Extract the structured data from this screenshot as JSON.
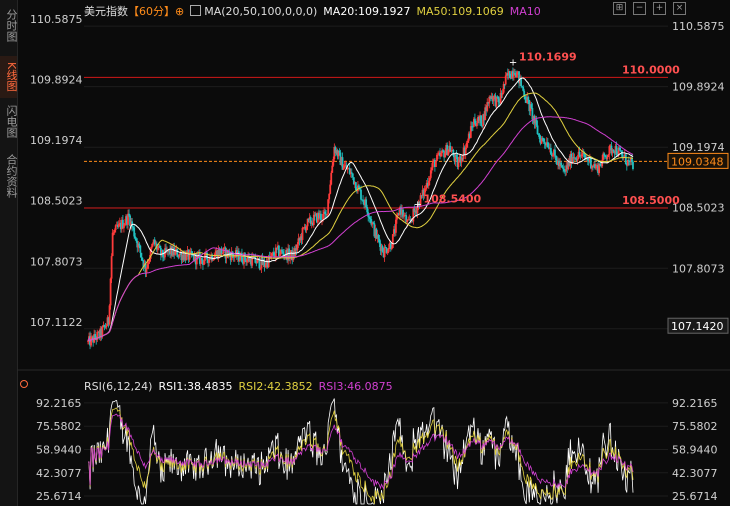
{
  "sidebar": {
    "tabs": [
      {
        "label": "分时图",
        "active": false
      },
      {
        "label": "K线图",
        "active": true
      },
      {
        "label": "闪电图",
        "active": false
      },
      {
        "label": "合约资料",
        "active": false
      }
    ]
  },
  "header": {
    "symbol": "美元指数",
    "period": "【60分】",
    "add_icon": "⊕",
    "ma_label": "MA(20,50,100,0,0,0)",
    "ma20": "MA20:109.1927",
    "ma50": "MA50:109.1069",
    "ma10": "MA10"
  },
  "rsi_header": {
    "label": "RSI(6,12,24)",
    "rsi1": "RSI1:38.4835",
    "rsi2": "RSI2:42.3852",
    "rsi3": "RSI3:46.0875"
  },
  "colors": {
    "ma20": "#ffffff",
    "ma50": "#e0d040",
    "ma100": "#d040d0",
    "up": "#ff3b3b",
    "down": "#20c0c0",
    "hline": "#d01818",
    "last_price": "#ff8c1a"
  },
  "chart_data": {
    "type": "candlestick",
    "y_ticks": [
      "110.5875",
      "109.8924",
      "109.1974",
      "108.5023",
      "107.8073",
      "107.1122"
    ],
    "ylim": [
      106.8,
      110.75
    ],
    "horizontal_lines": [
      {
        "value": 110.0,
        "label": "110.0000"
      },
      {
        "value": 108.5,
        "label": "108.5000"
      }
    ],
    "annotations": [
      {
        "label": "110.1699",
        "value": 110.1699
      },
      {
        "label": "108.5400",
        "value": 108.54
      }
    ],
    "last_price": {
      "value": 109.0348,
      "label": "109.0348"
    },
    "low_marker": {
      "value": 107.142,
      "label": "107.1420"
    },
    "rsi": {
      "y_ticks": [
        "92.2165",
        "75.5802",
        "58.9440",
        "42.3077",
        "25.6714"
      ],
      "ylim": [
        20,
        100
      ]
    },
    "close_anchors": [
      [
        0,
        106.95
      ],
      [
        3,
        107.05
      ],
      [
        5,
        107.2
      ],
      [
        6,
        108.2
      ],
      [
        8,
        108.3
      ],
      [
        10,
        108.4
      ],
      [
        12,
        108.1
      ],
      [
        14,
        107.8
      ],
      [
        16,
        108.1
      ],
      [
        18,
        107.95
      ],
      [
        20,
        108.0
      ],
      [
        24,
        107.95
      ],
      [
        28,
        107.9
      ],
      [
        32,
        108.0
      ],
      [
        36,
        107.95
      ],
      [
        40,
        107.9
      ],
      [
        43,
        107.85
      ],
      [
        46,
        108.0
      ],
      [
        50,
        107.95
      ],
      [
        53,
        108.3
      ],
      [
        56,
        108.4
      ],
      [
        58,
        108.4
      ],
      [
        60,
        109.2
      ],
      [
        62,
        109.0
      ],
      [
        64,
        108.9
      ],
      [
        66,
        108.7
      ],
      [
        68,
        108.5
      ],
      [
        70,
        108.2
      ],
      [
        72,
        108.0
      ],
      [
        74,
        108.1
      ],
      [
        76,
        108.5
      ],
      [
        78,
        108.3
      ],
      [
        80,
        108.5
      ],
      [
        82,
        108.7
      ],
      [
        84,
        109.0
      ],
      [
        86,
        109.1
      ],
      [
        88,
        109.2
      ],
      [
        90,
        109.0
      ],
      [
        92,
        109.2
      ],
      [
        94,
        109.5
      ],
      [
        96,
        109.5
      ],
      [
        98,
        109.8
      ],
      [
        100,
        109.7
      ],
      [
        102,
        110.0
      ],
      [
        104,
        110.1
      ],
      [
        106,
        109.85
      ],
      [
        108,
        109.6
      ],
      [
        110,
        109.3
      ],
      [
        112,
        109.25
      ],
      [
        114,
        109.05
      ],
      [
        116,
        108.9
      ],
      [
        118,
        109.1
      ],
      [
        120,
        109.1
      ],
      [
        122,
        109.05
      ],
      [
        124,
        108.95
      ],
      [
        126,
        109.1
      ],
      [
        128,
        109.2
      ],
      [
        130,
        109.1
      ],
      [
        132,
        109.0
      ]
    ]
  }
}
